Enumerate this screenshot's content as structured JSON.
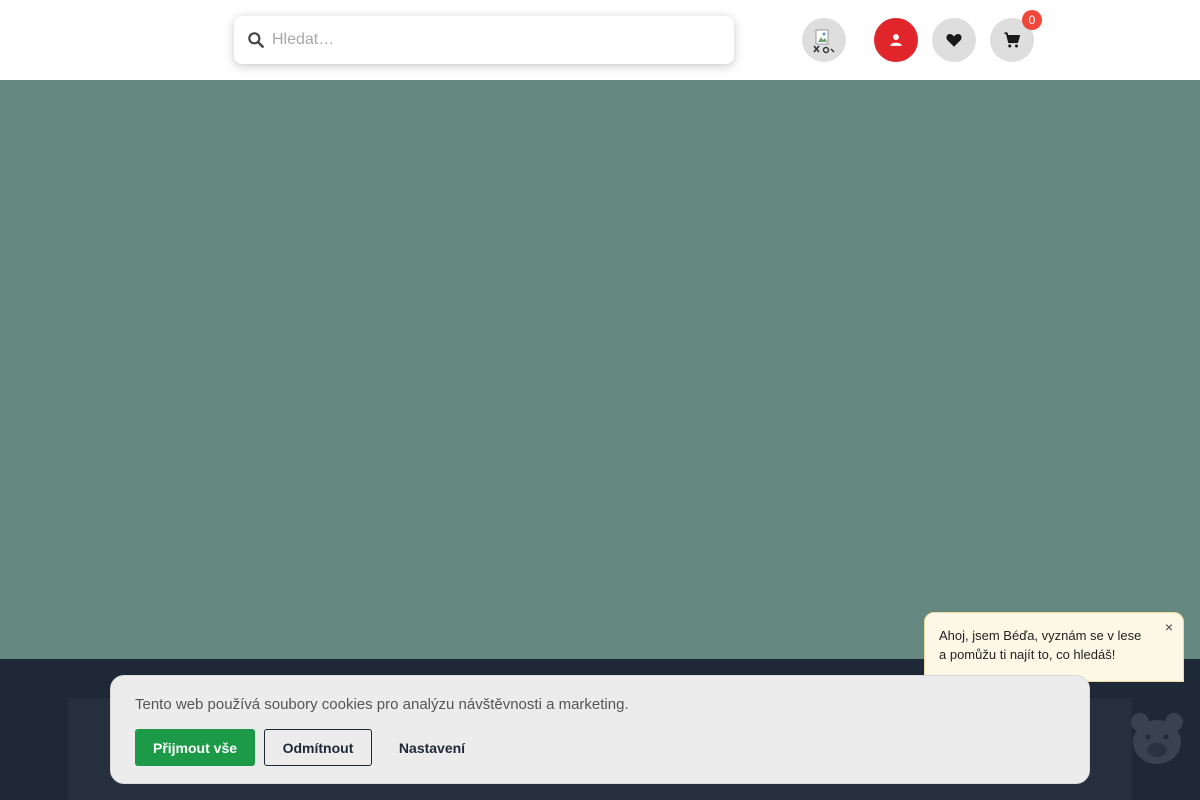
{
  "header": {
    "search": {
      "placeholder": "Hledat…",
      "icon": "search-icon"
    },
    "language_icon": "language-flag-icon",
    "user_icon": "user-icon",
    "wishlist_icon": "heart-icon",
    "cart_icon": "cart-icon",
    "cart_count": "0"
  },
  "colors": {
    "hero": "#648880",
    "dark": "#1f2836",
    "accent_red": "#e1262b",
    "accept_green": "#1d9a47"
  },
  "cookie": {
    "message": "Tento web používá soubory cookies pro analýzu návštěvnosti a marketing.",
    "accept_label": "Přijmout vše",
    "reject_label": "Odmítnout",
    "settings_label": "Nastavení"
  },
  "chat": {
    "message": "Ahoj, jsem Béďa, vyznám se v lese a pomůžu ti najít to, co hledáš!",
    "close_label": "×"
  }
}
